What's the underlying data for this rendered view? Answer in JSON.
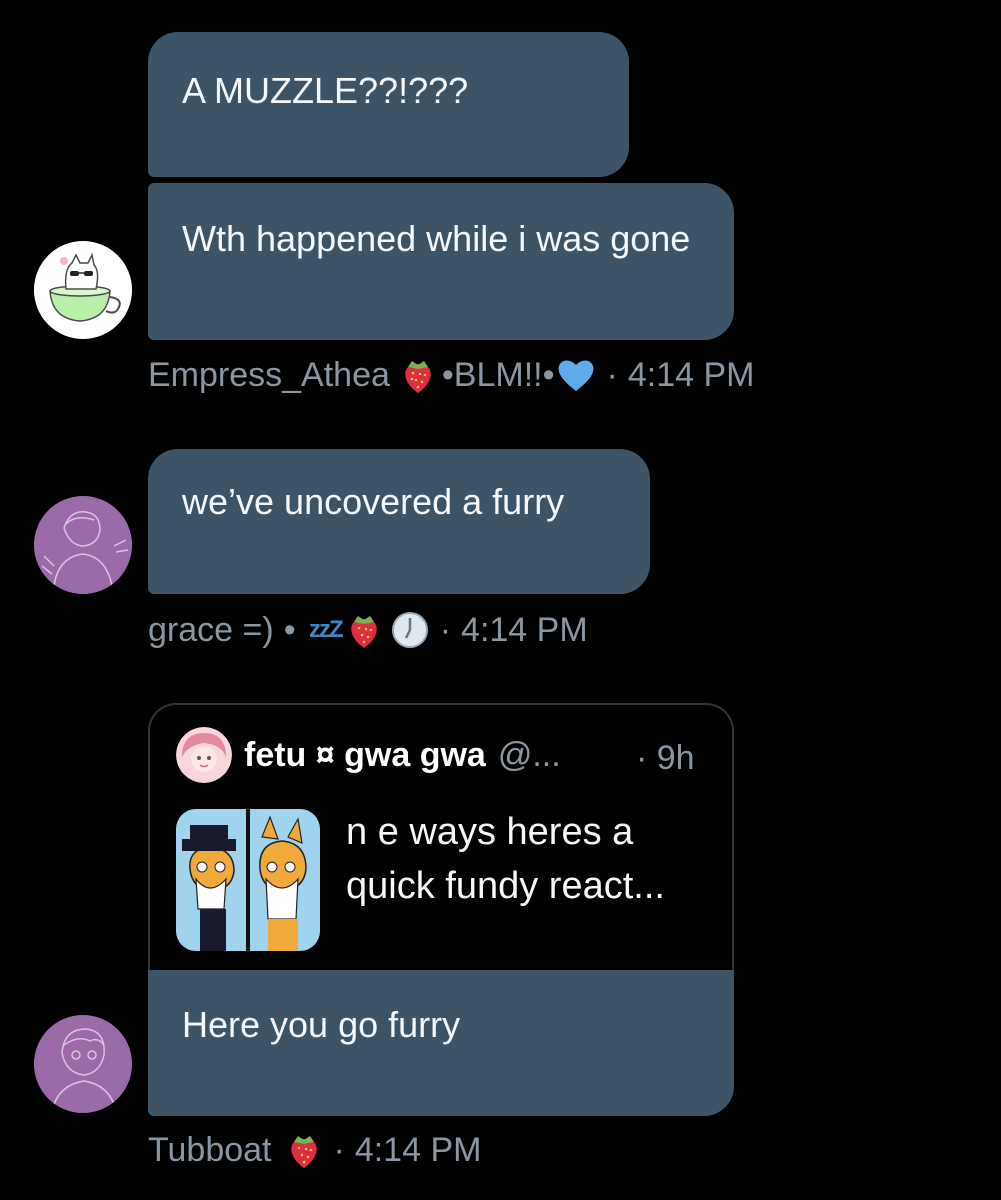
{
  "colors": {
    "background": "#000000",
    "bubble": "#3d5466",
    "meta_text": "#8a97a3",
    "card_border": "#2f3336"
  },
  "messages": [
    {
      "text": "A MUZZLE??!???"
    },
    {
      "text": "Wth happened while i was gone"
    },
    {
      "text": "we’ve uncovered a furry"
    },
    {
      "text": "Here you go furry"
    }
  ],
  "meta": [
    {
      "name": "Empress_Athea",
      "suffix": "•BLM!!•",
      "time": "4:14 PM",
      "icons": [
        "strawberry-icon",
        "blue-heart-icon"
      ]
    },
    {
      "name": "grace =)",
      "suffix": "• ",
      "zzz": "zzZ",
      "time": "4:14 PM",
      "icons": [
        "sleeping-icon",
        "strawberry-icon",
        "clock-icon"
      ]
    },
    {
      "name": "Tubboat",
      "time": "4:14 PM",
      "icons": [
        "strawberry-icon"
      ]
    }
  ],
  "quote": {
    "name": "fetu ¤ gwa gwa",
    "handle": "@...",
    "time": "· 9h",
    "text": "n e ways heres a quick fundy react...",
    "thumbnail_icon": "fox-meme-thumbnail"
  },
  "separator": "·"
}
